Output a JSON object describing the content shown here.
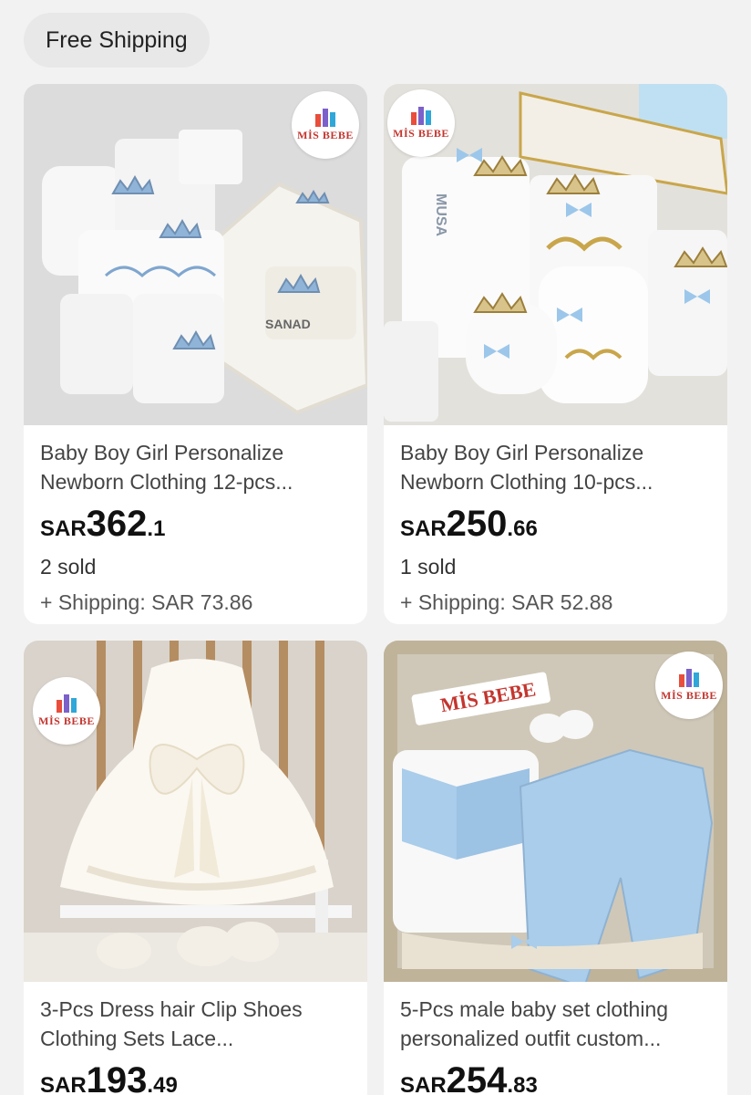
{
  "filter": {
    "chip_label": "Free Shipping"
  },
  "brand": {
    "logo_text": "MİS BEBE"
  },
  "products": [
    {
      "title_line1": "Baby Boy Girl Personalize",
      "title_line2": "Newborn Clothing 12-pcs...",
      "currency": "SAR",
      "price_int": "362",
      "price_dec": ".1",
      "sold": "2 sold",
      "shipping": "+ Shipping: SAR 73.86",
      "image_label": "SANAD"
    },
    {
      "title_line1": "Baby Boy Girl Personalize",
      "title_line2": "Newborn Clothing 10-pcs...",
      "currency": "SAR",
      "price_int": "250",
      "price_dec": ".66",
      "sold": "1 sold",
      "shipping": "+ Shipping: SAR 52.88",
      "image_label": "MUSA"
    },
    {
      "title_line1": "3-Pcs Dress hair Clip Shoes",
      "title_line2": "Clothing Sets Lace...",
      "currency": "SAR",
      "price_int": "193",
      "price_dec": ".49"
    },
    {
      "title_line1": "5-Pcs male baby set clothing",
      "title_line2": "personalized outfit custom...",
      "currency": "SAR",
      "price_int": "254",
      "price_dec": ".83"
    }
  ],
  "colors": {
    "accent_red": "#c3362f",
    "card_bg": "#ffffff",
    "page_bg": "#f2f2f2",
    "light_blue": "#a9cdea",
    "gold": "#c9a64b"
  }
}
